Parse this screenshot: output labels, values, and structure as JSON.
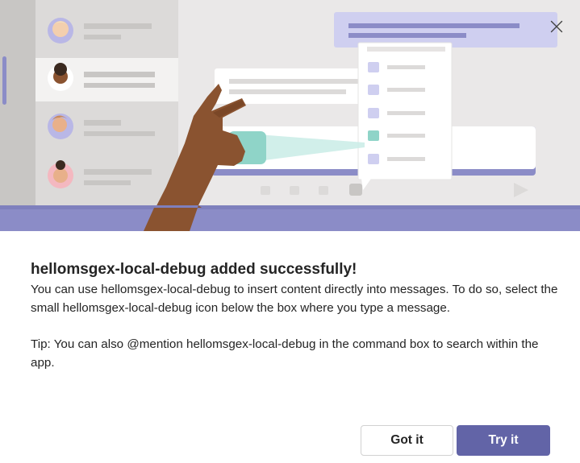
{
  "dialog": {
    "title": "hellomsgex-local-debug added successfully!",
    "body": "You can use hellomsgex-local-debug to insert content directly into messages. To do so, select the small hellomsgex-local-debug icon below the box where you type a message.",
    "tip": "Tip: You can also @mention hellomsgex-local-debug in the command box to search within the app."
  },
  "buttons": {
    "secondary_label": "Got it",
    "primary_label": "Try it"
  },
  "icons": {
    "close": "close-icon"
  },
  "colors": {
    "accent": "#6264a7",
    "illustration_bg": "#eae8e8",
    "band": "#8b8cc7",
    "teal": "#8fd4c8",
    "skin": "#8a5330"
  }
}
